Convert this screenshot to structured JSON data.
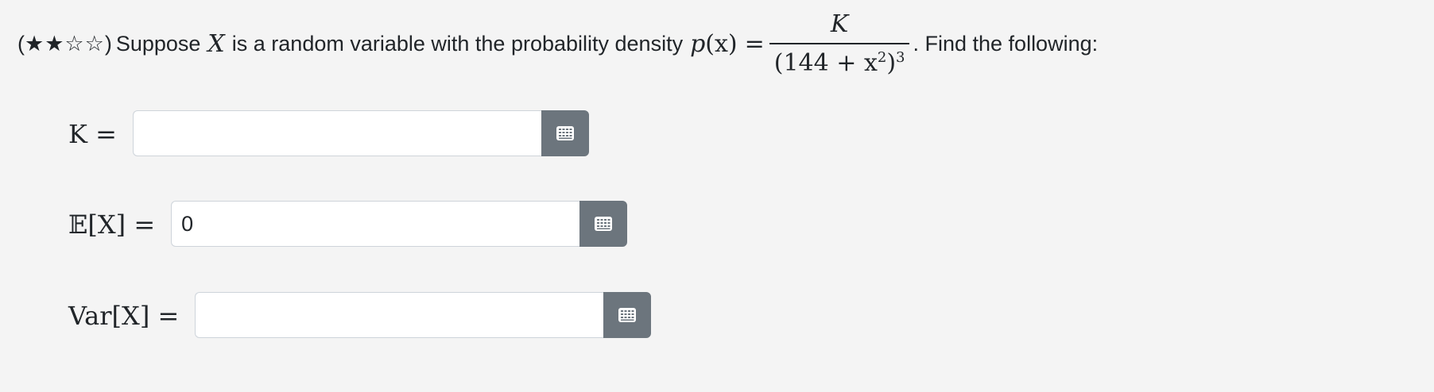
{
  "question": {
    "rating": "★★☆☆",
    "open_paren": "(",
    "close_paren": ")",
    "text_before": "Suppose",
    "var_x": "X",
    "text_middle": "is a random variable with the probability density",
    "density_lhs_p": "p",
    "density_lhs_arg": "(x)",
    "equals": "=",
    "numerator": "K",
    "denominator_base": "(144 + x",
    "denominator_inner_exp": "2",
    "denominator_close": ")",
    "denominator_outer_exp": "3",
    "text_after": ". Find the following:"
  },
  "fields": [
    {
      "label": "K =",
      "value": "",
      "button_icon": "keyboard-icon"
    },
    {
      "label": "𝔼[X] =",
      "value": "0",
      "button_icon": "keyboard-icon"
    },
    {
      "label": "Var[X] =",
      "value": "",
      "button_icon": "keyboard-icon"
    }
  ],
  "colors": {
    "background": "#f4f4f4",
    "button": "#6c757d",
    "input_border": "#ced4da"
  }
}
